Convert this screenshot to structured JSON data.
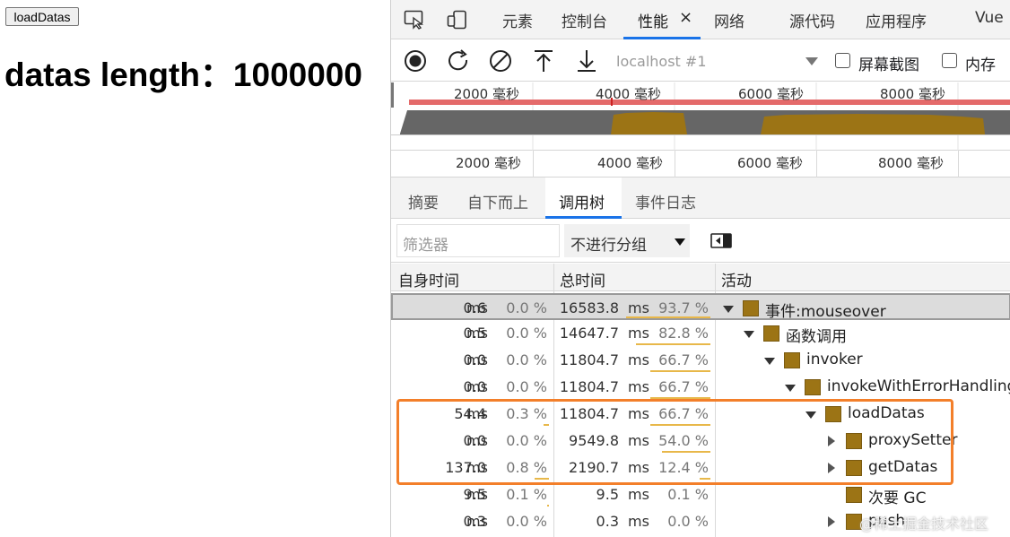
{
  "page": {
    "button_label": "loadDatas",
    "heading": "datas length：1000000"
  },
  "devtools": {
    "tabs": [
      {
        "label": "元素"
      },
      {
        "label": "控制台"
      },
      {
        "label": "性能",
        "active": true,
        "close": "×"
      },
      {
        "label": "网络"
      },
      {
        "label": "源代码"
      },
      {
        "label": "应用程序"
      },
      {
        "label": "Vue"
      }
    ],
    "toolbar": {
      "target": "localhost #1",
      "screenshots_label": "屏幕截图",
      "memory_label": "内存"
    },
    "overview_ticks": [
      "2000 毫秒",
      "4000 毫秒",
      "6000 毫秒",
      "8000 毫秒"
    ],
    "ruler_ticks": [
      "2000 毫秒",
      "4000 毫秒",
      "6000 毫秒",
      "8000 毫秒"
    ],
    "subtabs": [
      {
        "label": "摘要"
      },
      {
        "label": "自下而上"
      },
      {
        "label": "调用树",
        "active": true
      },
      {
        "label": "事件日志"
      }
    ],
    "filter": {
      "placeholder": "筛选器",
      "grouping": "不进行分组"
    },
    "columns": {
      "self": "自身时间",
      "total": "总时间",
      "activity": "活动"
    },
    "unit": "ms",
    "rows": [
      {
        "self": "0.6",
        "self_pct": "0.0 %",
        "total": "16583.8",
        "total_pct": "93.7 %",
        "total_frac": 0.937,
        "self_frac": 0.0,
        "name": "事件:mouseover",
        "depth": 0,
        "toggle": "down",
        "selected": true
      },
      {
        "self": "0.5",
        "self_pct": "0.0 %",
        "total": "14647.7",
        "total_pct": "82.8 %",
        "total_frac": 0.828,
        "self_frac": 0.0,
        "name": "函数调用",
        "depth": 1,
        "toggle": "down"
      },
      {
        "self": "0.0",
        "self_pct": "0.0 %",
        "total": "11804.7",
        "total_pct": "66.7 %",
        "total_frac": 0.667,
        "self_frac": 0.0,
        "name": "invoker",
        "depth": 2,
        "toggle": "down"
      },
      {
        "self": "0.0",
        "self_pct": "0.0 %",
        "total": "11804.7",
        "total_pct": "66.7 %",
        "total_frac": 0.667,
        "self_frac": 0.0,
        "name": "invokeWithErrorHandling",
        "depth": 3,
        "toggle": "down"
      },
      {
        "self": "54.4",
        "self_pct": "0.3 %",
        "total": "11804.7",
        "total_pct": "66.7 %",
        "total_frac": 0.667,
        "self_frac": 0.003,
        "name": "loadDatas",
        "depth": 4,
        "toggle": "down"
      },
      {
        "self": "0.0",
        "self_pct": "0.0 %",
        "total": "9549.8",
        "total_pct": "54.0 %",
        "total_frac": 0.54,
        "self_frac": 0.0,
        "name": "proxySetter",
        "depth": 5,
        "toggle": "right"
      },
      {
        "self": "137.0",
        "self_pct": "0.8 %",
        "total": "2190.7",
        "total_pct": "12.4 %",
        "total_frac": 0.124,
        "self_frac": 0.008,
        "name": "getDatas",
        "depth": 5,
        "toggle": "right"
      },
      {
        "self": "9.5",
        "self_pct": "0.1 %",
        "total": "9.5",
        "total_pct": "0.1 %",
        "total_frac": 0.001,
        "self_frac": 0.001,
        "name": "次要 GC",
        "depth": 5,
        "toggle": "none"
      },
      {
        "self": "0.3",
        "self_pct": "0.0 %",
        "total": "0.3",
        "total_pct": "0.0 %",
        "total_frac": 0.0,
        "self_frac": 0.0,
        "name": "push",
        "depth": 5,
        "toggle": "right"
      }
    ],
    "watermark": "@稀土掘金技术社区"
  },
  "colors": {
    "activity_swatch": "#9c7415",
    "highlight": "#f37f2a",
    "accent": "#1a73e8",
    "bar": "#e8b84a"
  }
}
